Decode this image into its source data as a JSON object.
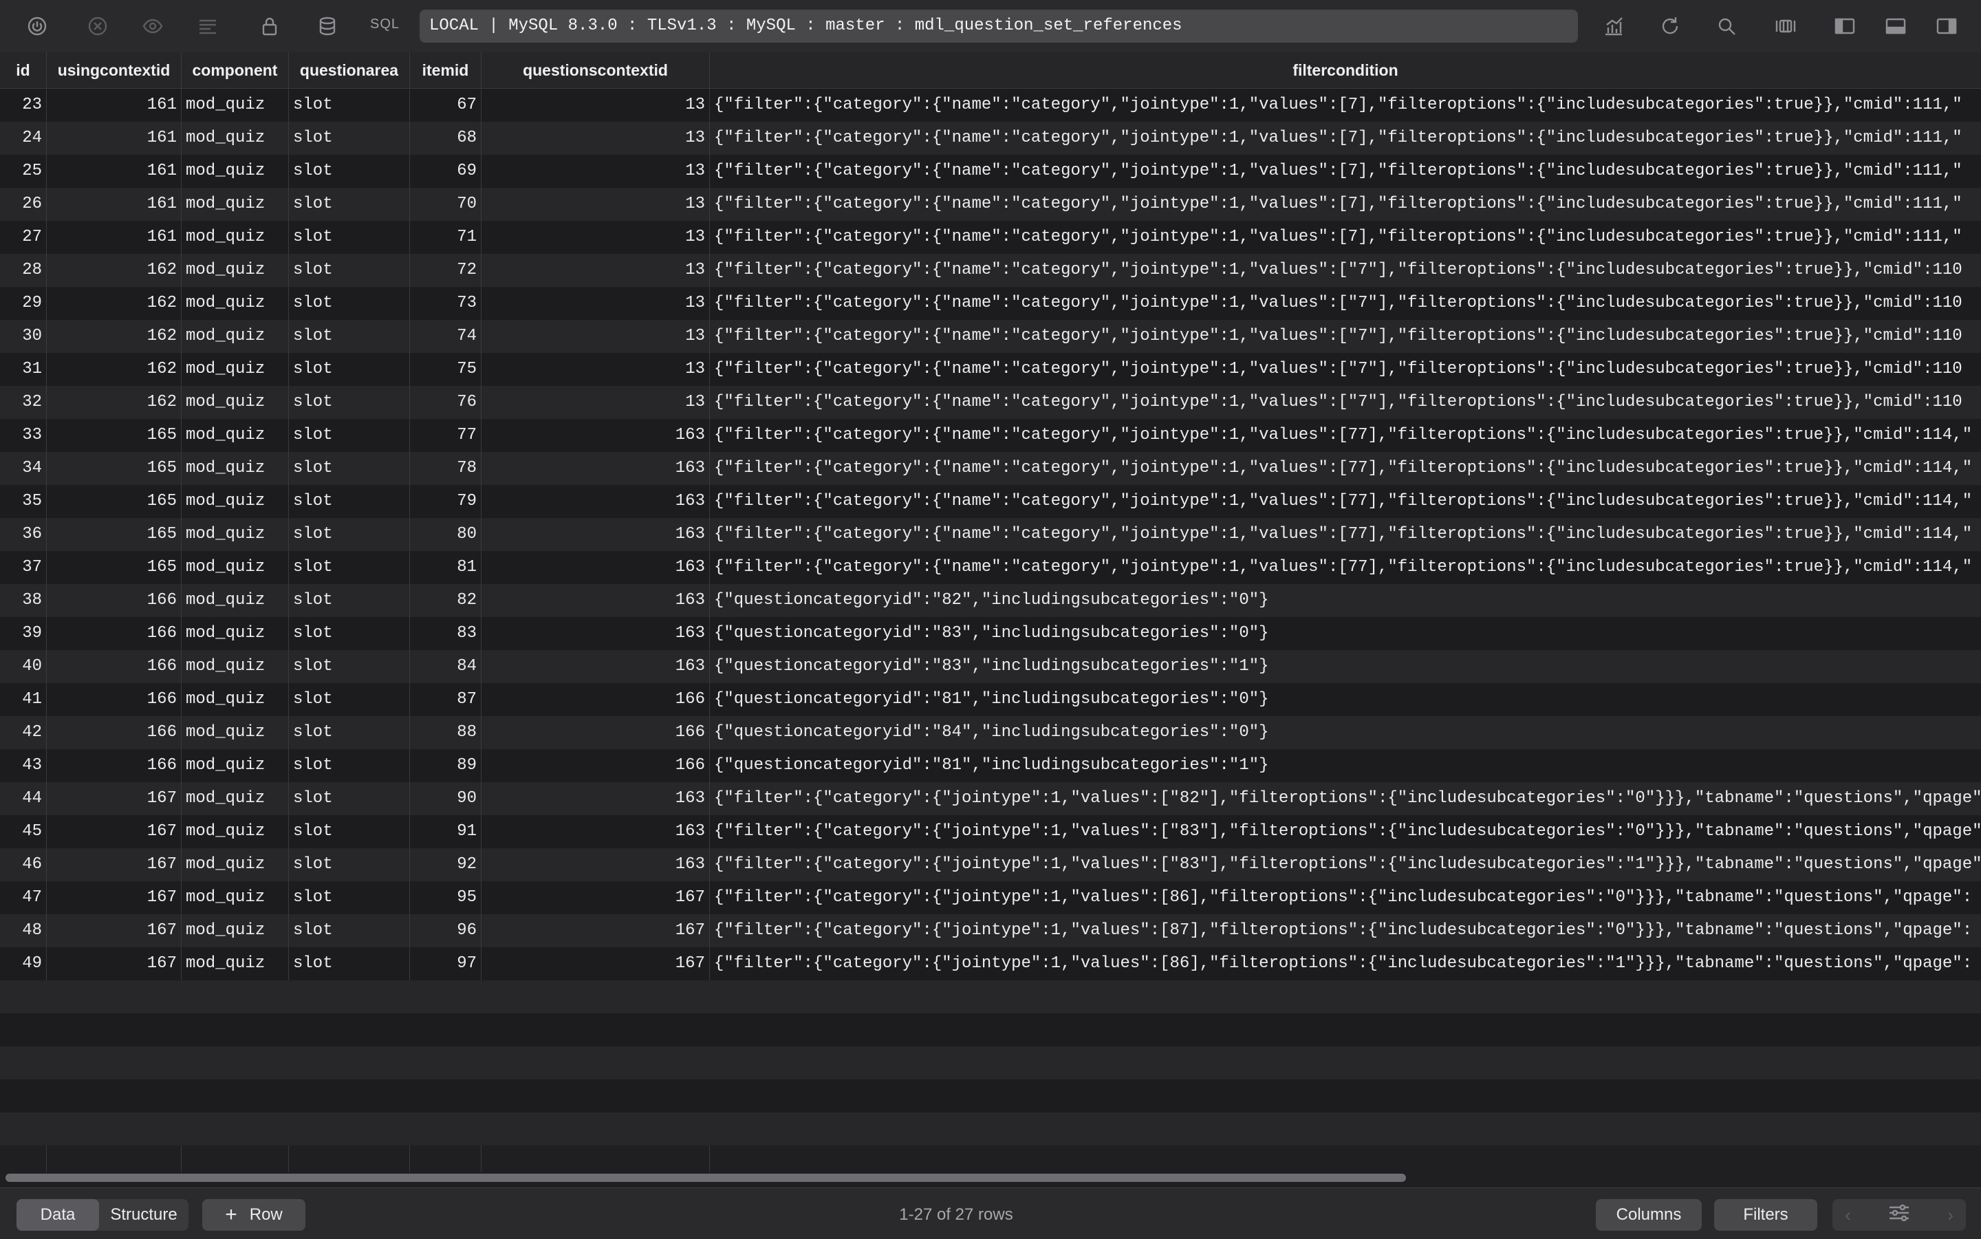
{
  "toolbar": {
    "sql_label": "SQL",
    "connection": "LOCAL | MySQL 8.3.0 : TLSv1.3 : MySQL : master : mdl_question_set_references",
    "icons": [
      "power-icon",
      "close-circle-icon",
      "eye-icon",
      "list-icon",
      "lock-icon",
      "database-icon",
      "chart-icon",
      "refresh-icon",
      "search-icon",
      "panels-icon",
      "left-sidebar-icon",
      "bottom-panel-icon",
      "right-sidebar-icon"
    ]
  },
  "table": {
    "columns": [
      "id",
      "usingcontextid",
      "component",
      "questionarea",
      "itemid",
      "questionscontextid",
      "filtercondition"
    ],
    "rows": [
      [
        "23",
        "161",
        "mod_quiz",
        "slot",
        "67",
        "13",
        "{\"filter\":{\"category\":{\"name\":\"category\",\"jointype\":1,\"values\":[7],\"filteroptions\":{\"includesubcategories\":true}},\"cmid\":111,\""
      ],
      [
        "24",
        "161",
        "mod_quiz",
        "slot",
        "68",
        "13",
        "{\"filter\":{\"category\":{\"name\":\"category\",\"jointype\":1,\"values\":[7],\"filteroptions\":{\"includesubcategories\":true}},\"cmid\":111,\""
      ],
      [
        "25",
        "161",
        "mod_quiz",
        "slot",
        "69",
        "13",
        "{\"filter\":{\"category\":{\"name\":\"category\",\"jointype\":1,\"values\":[7],\"filteroptions\":{\"includesubcategories\":true}},\"cmid\":111,\""
      ],
      [
        "26",
        "161",
        "mod_quiz",
        "slot",
        "70",
        "13",
        "{\"filter\":{\"category\":{\"name\":\"category\",\"jointype\":1,\"values\":[7],\"filteroptions\":{\"includesubcategories\":true}},\"cmid\":111,\""
      ],
      [
        "27",
        "161",
        "mod_quiz",
        "slot",
        "71",
        "13",
        "{\"filter\":{\"category\":{\"name\":\"category\",\"jointype\":1,\"values\":[7],\"filteroptions\":{\"includesubcategories\":true}},\"cmid\":111,\""
      ],
      [
        "28",
        "162",
        "mod_quiz",
        "slot",
        "72",
        "13",
        "{\"filter\":{\"category\":{\"name\":\"category\",\"jointype\":1,\"values\":[\"7\"],\"filteroptions\":{\"includesubcategories\":true}},\"cmid\":110"
      ],
      [
        "29",
        "162",
        "mod_quiz",
        "slot",
        "73",
        "13",
        "{\"filter\":{\"category\":{\"name\":\"category\",\"jointype\":1,\"values\":[\"7\"],\"filteroptions\":{\"includesubcategories\":true}},\"cmid\":110"
      ],
      [
        "30",
        "162",
        "mod_quiz",
        "slot",
        "74",
        "13",
        "{\"filter\":{\"category\":{\"name\":\"category\",\"jointype\":1,\"values\":[\"7\"],\"filteroptions\":{\"includesubcategories\":true}},\"cmid\":110"
      ],
      [
        "31",
        "162",
        "mod_quiz",
        "slot",
        "75",
        "13",
        "{\"filter\":{\"category\":{\"name\":\"category\",\"jointype\":1,\"values\":[\"7\"],\"filteroptions\":{\"includesubcategories\":true}},\"cmid\":110"
      ],
      [
        "32",
        "162",
        "mod_quiz",
        "slot",
        "76",
        "13",
        "{\"filter\":{\"category\":{\"name\":\"category\",\"jointype\":1,\"values\":[\"7\"],\"filteroptions\":{\"includesubcategories\":true}},\"cmid\":110"
      ],
      [
        "33",
        "165",
        "mod_quiz",
        "slot",
        "77",
        "163",
        "{\"filter\":{\"category\":{\"name\":\"category\",\"jointype\":1,\"values\":[77],\"filteroptions\":{\"includesubcategories\":true}},\"cmid\":114,\""
      ],
      [
        "34",
        "165",
        "mod_quiz",
        "slot",
        "78",
        "163",
        "{\"filter\":{\"category\":{\"name\":\"category\",\"jointype\":1,\"values\":[77],\"filteroptions\":{\"includesubcategories\":true}},\"cmid\":114,\""
      ],
      [
        "35",
        "165",
        "mod_quiz",
        "slot",
        "79",
        "163",
        "{\"filter\":{\"category\":{\"name\":\"category\",\"jointype\":1,\"values\":[77],\"filteroptions\":{\"includesubcategories\":true}},\"cmid\":114,\""
      ],
      [
        "36",
        "165",
        "mod_quiz",
        "slot",
        "80",
        "163",
        "{\"filter\":{\"category\":{\"name\":\"category\",\"jointype\":1,\"values\":[77],\"filteroptions\":{\"includesubcategories\":true}},\"cmid\":114,\""
      ],
      [
        "37",
        "165",
        "mod_quiz",
        "slot",
        "81",
        "163",
        "{\"filter\":{\"category\":{\"name\":\"category\",\"jointype\":1,\"values\":[77],\"filteroptions\":{\"includesubcategories\":true}},\"cmid\":114,\""
      ],
      [
        "38",
        "166",
        "mod_quiz",
        "slot",
        "82",
        "163",
        "{\"questioncategoryid\":\"82\",\"includingsubcategories\":\"0\"}"
      ],
      [
        "39",
        "166",
        "mod_quiz",
        "slot",
        "83",
        "163",
        "{\"questioncategoryid\":\"83\",\"includingsubcategories\":\"0\"}"
      ],
      [
        "40",
        "166",
        "mod_quiz",
        "slot",
        "84",
        "163",
        "{\"questioncategoryid\":\"83\",\"includingsubcategories\":\"1\"}"
      ],
      [
        "41",
        "166",
        "mod_quiz",
        "slot",
        "87",
        "166",
        "{\"questioncategoryid\":\"81\",\"includingsubcategories\":\"0\"}"
      ],
      [
        "42",
        "166",
        "mod_quiz",
        "slot",
        "88",
        "166",
        "{\"questioncategoryid\":\"84\",\"includingsubcategories\":\"0\"}"
      ],
      [
        "43",
        "166",
        "mod_quiz",
        "slot",
        "89",
        "166",
        "{\"questioncategoryid\":\"81\",\"includingsubcategories\":\"1\"}"
      ],
      [
        "44",
        "167",
        "mod_quiz",
        "slot",
        "90",
        "163",
        "{\"filter\":{\"category\":{\"jointype\":1,\"values\":[\"82\"],\"filteroptions\":{\"includesubcategories\":\"0\"}}},\"tabname\":\"questions\",\"qpage\""
      ],
      [
        "45",
        "167",
        "mod_quiz",
        "slot",
        "91",
        "163",
        "{\"filter\":{\"category\":{\"jointype\":1,\"values\":[\"83\"],\"filteroptions\":{\"includesubcategories\":\"0\"}}},\"tabname\":\"questions\",\"qpage\""
      ],
      [
        "46",
        "167",
        "mod_quiz",
        "slot",
        "92",
        "163",
        "{\"filter\":{\"category\":{\"jointype\":1,\"values\":[\"83\"],\"filteroptions\":{\"includesubcategories\":\"1\"}}},\"tabname\":\"questions\",\"qpage\""
      ],
      [
        "47",
        "167",
        "mod_quiz",
        "slot",
        "95",
        "167",
        "{\"filter\":{\"category\":{\"jointype\":1,\"values\":[86],\"filteroptions\":{\"includesubcategories\":\"0\"}}},\"tabname\":\"questions\",\"qpage\":"
      ],
      [
        "48",
        "167",
        "mod_quiz",
        "slot",
        "96",
        "167",
        "{\"filter\":{\"category\":{\"jointype\":1,\"values\":[87],\"filteroptions\":{\"includesubcategories\":\"0\"}}},\"tabname\":\"questions\",\"qpage\":"
      ],
      [
        "49",
        "167",
        "mod_quiz",
        "slot",
        "97",
        "167",
        "{\"filter\":{\"category\":{\"jointype\":1,\"values\":[86],\"filteroptions\":{\"includesubcategories\":\"1\"}}},\"tabname\":\"questions\",\"qpage\":"
      ]
    ]
  },
  "bottombar": {
    "data_tab": "Data",
    "structure_tab": "Structure",
    "add_row": "Row",
    "status": "1-27 of 27 rows",
    "columns": "Columns",
    "filters": "Filters"
  }
}
